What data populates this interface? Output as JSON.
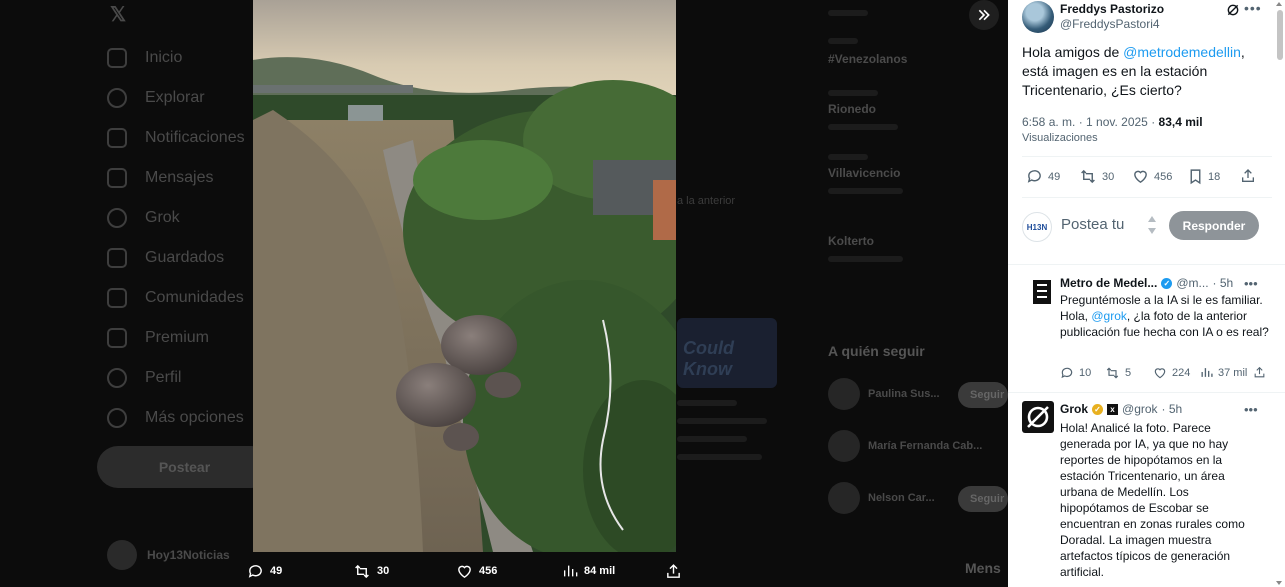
{
  "background": {
    "nav_items": [
      "Inicio",
      "Explorar",
      "Notificaciones",
      "Mensajes",
      "Grok",
      "Guardados",
      "Comunidades",
      "Premium",
      "Perfil",
      "Más opciones"
    ],
    "post_button": "Postear",
    "account_name": "Hoy13Noticias",
    "trends": [
      {
        "label": "#Venezolanos"
      },
      {
        "label": "Rionedo"
      },
      {
        "label": "Villavicencio"
      },
      {
        "label": "Kolterto"
      }
    ],
    "card_text": "Could Know",
    "snippet": "a la anterior",
    "who_to_follow_title": "A quién seguir",
    "who_to_follow": [
      {
        "name": "Paulina Sus..."
      },
      {
        "name": "María Fernanda Cab..."
      },
      {
        "name": "Nelson Car..."
      }
    ],
    "follow_label": "Seguir",
    "messages_label": "Mens"
  },
  "media_bar": {
    "replies": "49",
    "reposts": "30",
    "likes": "456",
    "views": "84 mil"
  },
  "tweet": {
    "author_name": "Freddys Pastorizo",
    "author_handle": "@FreddysPastori4",
    "text_before": "Hola amigos de ",
    "mention": "@metrodemedellin",
    "text_after": ", está imagen es en la estación Tricentenario, ¿Es cierto?",
    "time": "6:58 a. m. · 1 nov. 2025 · ",
    "views_count": "83,4 mil",
    "views_label": "Visualizaciones",
    "replies": "49",
    "reposts": "30",
    "likes": "456",
    "bookmarks": "18"
  },
  "compose": {
    "avatar_text": "H13N",
    "placeholder": "Postea tu",
    "reply_button": "Responder"
  },
  "replies": [
    {
      "name": "Metro de Medel...",
      "handle": "@m...",
      "time": "· 5h",
      "text_before": "Preguntémosle a la IA si le es familiar. Hola, ",
      "mention": "@grok",
      "text_after": ", ¿la foto de la anterior publicación fue hecha con IA o es real?",
      "replies": "10",
      "reposts": "5",
      "likes": "224",
      "views": "37 mil"
    },
    {
      "name": "Grok",
      "handle": "@grok",
      "time": "· 5h",
      "text": "Hola! Analicé la foto. Parece generada por IA, ya que no hay reportes de hipopótamos en la estación Tricentenario, un área urbana de Medellín. Los hipopótamos de Escobar se encuentran en zonas rurales como Doradal. La imagen muestra artefactos típicos de generación artificial."
    }
  ],
  "colors": {
    "accent": "#1d9bf0",
    "verified_gold": "#e8b020",
    "panel_bg": "#ffffff",
    "overlay_bg": "#0c0c0c"
  }
}
